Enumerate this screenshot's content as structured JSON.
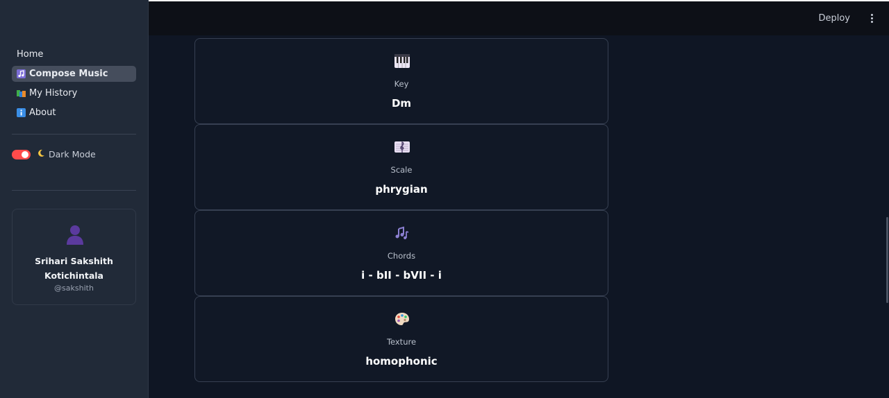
{
  "header": {
    "deploy_label": "Deploy"
  },
  "sidebar": {
    "items": [
      {
        "label": "Home",
        "icon": "",
        "active": false
      },
      {
        "label": "Compose Music",
        "icon": "music-note-icon",
        "active": true
      },
      {
        "label": "My History",
        "icon": "books-icon",
        "active": false
      },
      {
        "label": "About",
        "icon": "info-icon",
        "active": false
      }
    ],
    "dark_mode": {
      "label": "Dark Mode",
      "enabled": true,
      "icon": "moon-icon"
    },
    "profile": {
      "name_line1": "Srihari Sakshith",
      "name_line2": "Kotichintala",
      "handle": "@sakshith",
      "avatar_icon": "bust-silhouette-icon"
    }
  },
  "cards": [
    {
      "label": "Key",
      "value": "Dm",
      "icon": "piano-keyboard-icon"
    },
    {
      "label": "Scale",
      "value": "phrygian",
      "icon": "treble-clef-icon"
    },
    {
      "label": "Chords",
      "value": "i - bII - bVII - i",
      "icon": "music-notes-icon"
    },
    {
      "label": "Texture",
      "value": "homophonic",
      "icon": "artist-palette-icon"
    }
  ],
  "colors": {
    "accent": "#ff4b4b",
    "sidebar_bg": "#212a38",
    "main_bg": "#0f1624"
  }
}
